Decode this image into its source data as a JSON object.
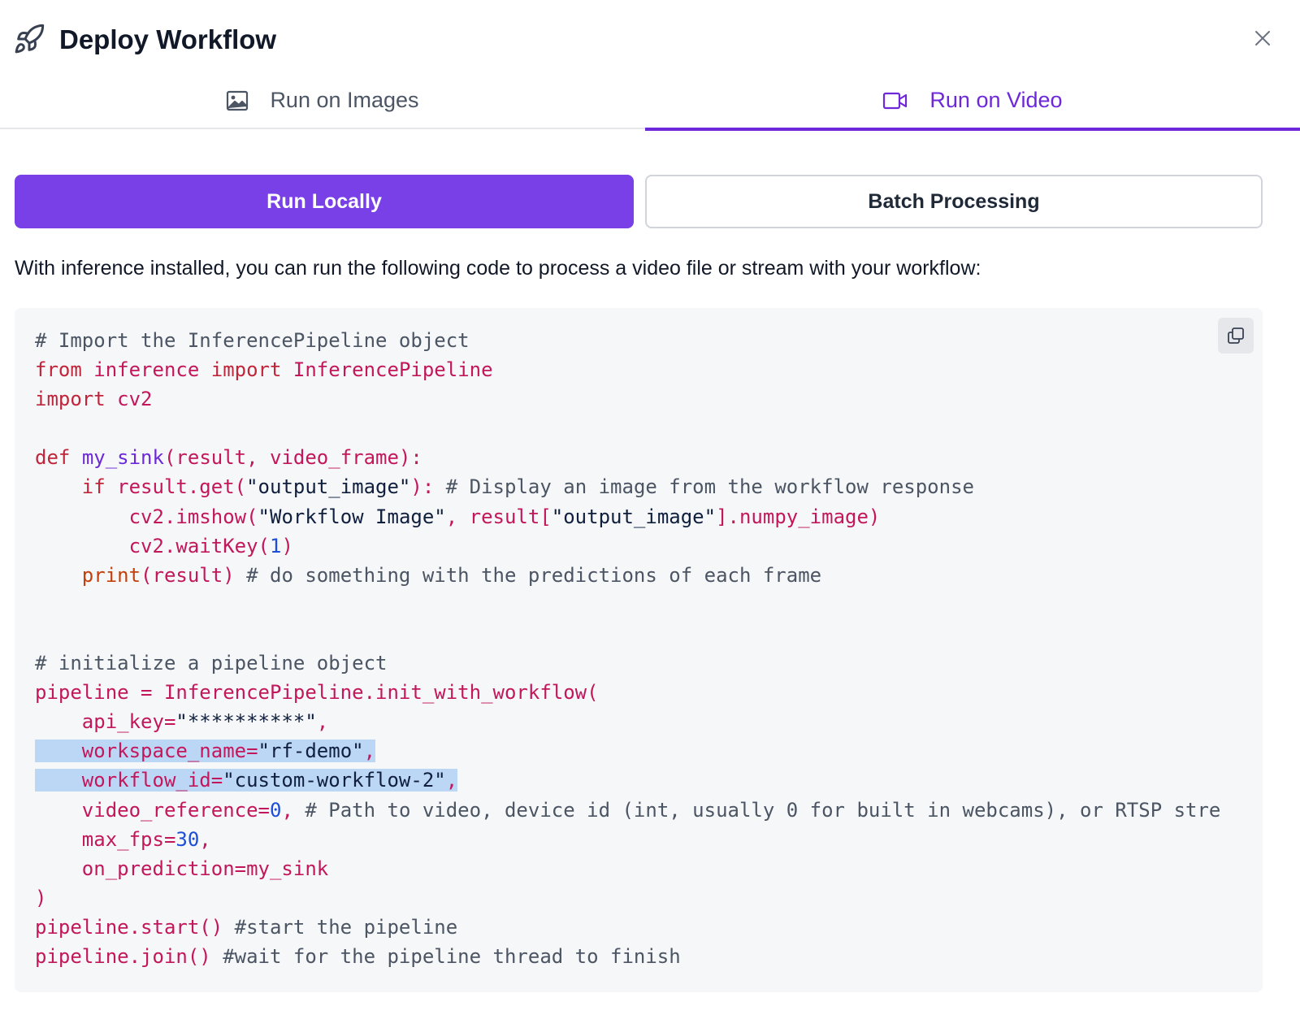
{
  "dialog": {
    "title": "Deploy Workflow",
    "title_icon": "rocket-icon",
    "close_icon": "close-icon"
  },
  "tabs": [
    {
      "label": "Run on Images",
      "icon": "image-icon",
      "active": false
    },
    {
      "label": "Run on Video",
      "icon": "video-camera-icon",
      "active": true
    }
  ],
  "mode_buttons": {
    "run_locally": "Run Locally",
    "batch_processing": "Batch Processing"
  },
  "description": "With inference installed, you can run the following code to process a video file or stream with your workflow:",
  "code": {
    "copy_icon": "copy-icon",
    "lines": [
      [
        {
          "t": "# Import the InferencePipeline object",
          "c": "com"
        }
      ],
      [
        {
          "t": "from",
          "c": "kw"
        },
        {
          "t": " inference ",
          "c": "name"
        },
        {
          "t": "import",
          "c": "kw"
        },
        {
          "t": " InferencePipeline",
          "c": "name"
        }
      ],
      [
        {
          "t": "import",
          "c": "kw"
        },
        {
          "t": " cv2",
          "c": "name"
        }
      ],
      [],
      [
        {
          "t": "def",
          "c": "kw"
        },
        {
          "t": " ",
          "c": "name"
        },
        {
          "t": "my_sink",
          "c": "fn"
        },
        {
          "t": "(result, video_frame):",
          "c": "name"
        }
      ],
      [
        {
          "t": "    ",
          "c": "name"
        },
        {
          "t": "if",
          "c": "kw"
        },
        {
          "t": " result.get(",
          "c": "name"
        },
        {
          "t": "\"output_image\"",
          "c": "str"
        },
        {
          "t": "): ",
          "c": "name"
        },
        {
          "t": "# Display an image from the workflow response",
          "c": "com"
        }
      ],
      [
        {
          "t": "        cv2.imshow(",
          "c": "name"
        },
        {
          "t": "\"Workflow Image\"",
          "c": "str"
        },
        {
          "t": ", result[",
          "c": "name"
        },
        {
          "t": "\"output_image\"",
          "c": "str"
        },
        {
          "t": "].numpy_image)",
          "c": "name"
        }
      ],
      [
        {
          "t": "        cv2.waitKey(",
          "c": "name"
        },
        {
          "t": "1",
          "c": "num"
        },
        {
          "t": ")",
          "c": "name"
        }
      ],
      [
        {
          "t": "    ",
          "c": "name"
        },
        {
          "t": "print",
          "c": "bi"
        },
        {
          "t": "(result) ",
          "c": "name"
        },
        {
          "t": "# do something with the predictions of each frame",
          "c": "com"
        }
      ],
      [],
      [],
      [
        {
          "t": "# initialize a pipeline object",
          "c": "com"
        }
      ],
      [
        {
          "t": "pipeline = InferencePipeline.init_with_workflow(",
          "c": "name"
        }
      ],
      [
        {
          "t": "    api_key=",
          "c": "name"
        },
        {
          "t": "\"**********\"",
          "c": "str"
        },
        {
          "t": ",",
          "c": "name"
        }
      ],
      {
        "hl": true,
        "segs": [
          {
            "t": "    workspace_name=",
            "c": "name"
          },
          {
            "t": "\"rf-demo\"",
            "c": "str"
          },
          {
            "t": ",",
            "c": "name"
          }
        ]
      },
      {
        "hl": true,
        "segs": [
          {
            "t": "    workflow_id=",
            "c": "name"
          },
          {
            "t": "\"custom-workflow-2\"",
            "c": "str"
          },
          {
            "t": ",",
            "c": "name"
          }
        ]
      },
      [
        {
          "t": "    video_reference=",
          "c": "name"
        },
        {
          "t": "0",
          "c": "num"
        },
        {
          "t": ", ",
          "c": "name"
        },
        {
          "t": "# Path to video, device id (int, usually 0 for built in webcams), or RTSP stre",
          "c": "com"
        }
      ],
      [
        {
          "t": "    max_fps=",
          "c": "name"
        },
        {
          "t": "30",
          "c": "num"
        },
        {
          "t": ",",
          "c": "name"
        }
      ],
      [
        {
          "t": "    on_prediction=my_sink",
          "c": "name"
        }
      ],
      [
        {
          "t": ")",
          "c": "name"
        }
      ],
      [
        {
          "t": "pipeline.start() ",
          "c": "name"
        },
        {
          "t": "#start the pipeline",
          "c": "com"
        }
      ],
      [
        {
          "t": "pipeline.join() ",
          "c": "name"
        },
        {
          "t": "#wait for the pipeline thread to finish",
          "c": "com"
        }
      ]
    ]
  }
}
